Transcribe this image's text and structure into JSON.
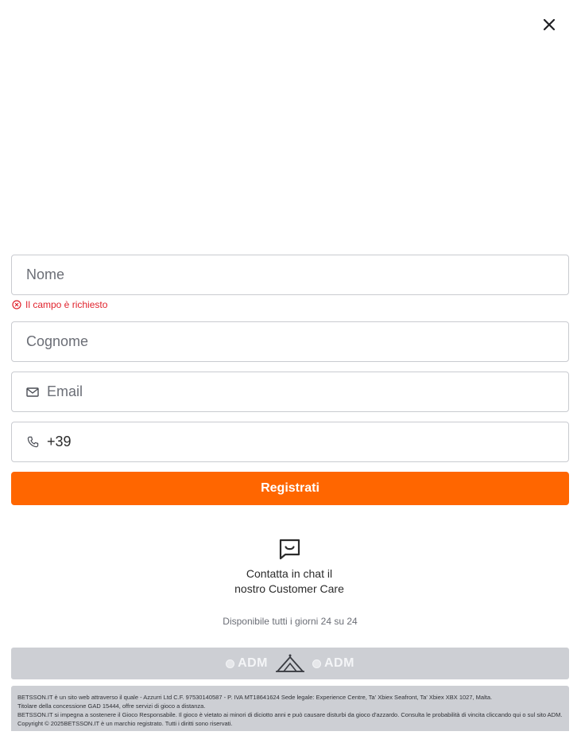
{
  "form": {
    "first_name_placeholder": "Nome",
    "first_name_error": "Il campo è richiesto",
    "last_name_placeholder": "Cognome",
    "email_placeholder": "Email",
    "phone_value": "+39",
    "submit_label": "Registrati"
  },
  "support": {
    "chat_line1": "Contatta in chat il",
    "chat_line2": "nostro Customer Care",
    "availability": "Disponibile tutti i giorni 24 su 24"
  },
  "footer": {
    "logos": [
      "ADM",
      "ADM"
    ],
    "legal_lines": [
      "BETSSON.IT è un sito web attraverso il quale - Azzurri Ltd C.F. 97530140587 - P. IVA MT18641624 Sede legale: Experience Centre, Ta' Xbiex Seafront, Ta' Xbiex XBX 1027, Malta.",
      "Titolare della concessione GAD 15444, offre servizi di gioco a distanza.",
      "BETSSON.IT si impegna a sostenere il Gioco Responsabile. Il gioco è vietato ai minori di diciotto anni e può causare disturbi da gioco d'azzardo. Consulta le probabilità di vincita cliccando qui o sul sito ADM.",
      "Copyright © 2025BETSSON.IT è un marchio registrato. Tutti i diritti sono riservati."
    ]
  },
  "icons": {
    "close": "close-icon",
    "error": "error-circle-icon",
    "email": "mail-icon",
    "phone": "phone-icon",
    "chat": "chat-icon"
  },
  "colors": {
    "accent": "#ff6600",
    "error": "#e0232d",
    "footer_bg": "#cdcfd4"
  }
}
